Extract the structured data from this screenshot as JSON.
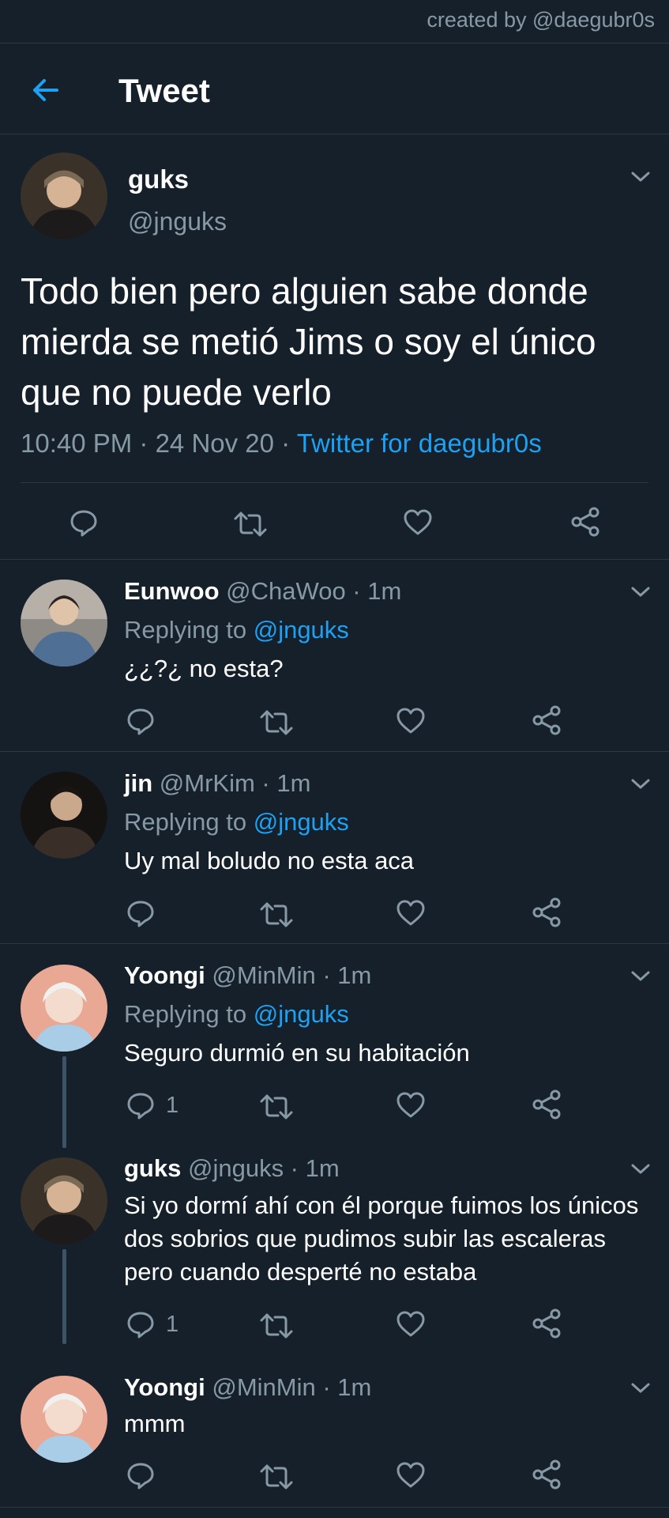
{
  "watermark": "created by @daegubr0s",
  "header": {
    "title": "Tweet",
    "back_icon": "arrow-left-icon"
  },
  "main_tweet": {
    "name": "guks",
    "handle": "@jnguks",
    "text": "Todo bien pero alguien sabe donde mierda se metió Jims o soy el único que no puede verlo",
    "time": "10:40 PM",
    "sep1": " · ",
    "date": "24 Nov 20",
    "sep2": " · ",
    "source": "Twitter for daegubr0s"
  },
  "replies": [
    {
      "name": "Eunwoo",
      "handle": "@ChaWoo · 1m",
      "replying_prefix": "Replying to ",
      "replying_to": "@jnguks",
      "text": "¿¿?¿ no esta?",
      "reply_count": ""
    },
    {
      "name": "jin",
      "handle": "@MrKim · 1m",
      "replying_prefix": "Replying to ",
      "replying_to": "@jnguks",
      "text": "Uy mal boludo no esta aca",
      "reply_count": ""
    },
    {
      "name": "Yoongi",
      "handle": "@MinMin · 1m",
      "replying_prefix": "Replying to ",
      "replying_to": "@jnguks",
      "text": "Seguro durmió en su habitación",
      "reply_count": "1"
    },
    {
      "name": "guks",
      "handle": "@jnguks · 1m",
      "text": "Si yo dormí ahí con él porque fuimos los únicos dos sobrios que pudimos subir las escaleras pero cuando desperté no estaba",
      "reply_count": "1"
    },
    {
      "name": "Yoongi",
      "handle": "@MinMin · 1m",
      "text": "mmm",
      "reply_count": ""
    }
  ],
  "colors": {
    "background": "#15202b",
    "accent": "#1da1f2",
    "muted": "#8899a6",
    "divider": "#2a3845"
  },
  "icons": [
    "comment-icon",
    "retweet-icon",
    "like-icon",
    "share-icon",
    "chevron-down-icon"
  ]
}
